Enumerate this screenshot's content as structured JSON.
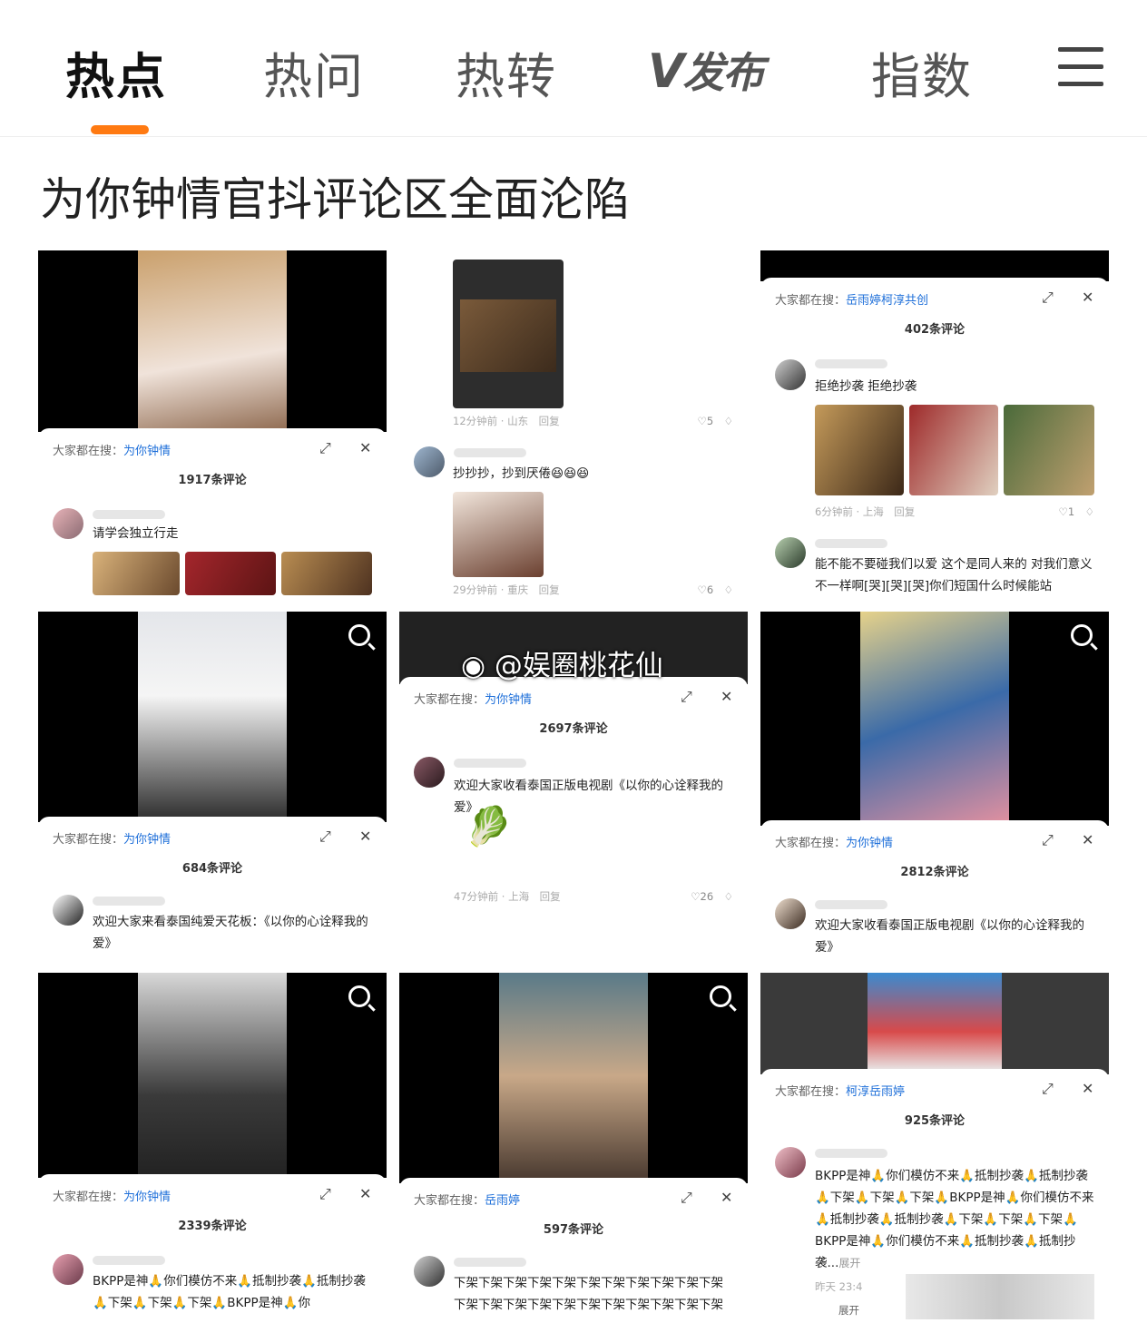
{
  "nav": {
    "tabs": [
      "热点",
      "热问",
      "热转"
    ],
    "publish": {
      "mark": "V",
      "label": "发布"
    },
    "index_tab": "指数",
    "accent": "#ff7a12"
  },
  "headline": "为你钟情官抖评论区全面沦陷",
  "search_label": "大家都在搜：",
  "cards": [
    {
      "keyword": "为你钟情",
      "count": "1917条评论",
      "comment": "请学会独立行走"
    },
    {
      "top_meta": "12分钟前 · 山东",
      "top_reply": "回复",
      "top_likes": "5",
      "comment": "抄抄抄，抄到厌倦😆😆😆",
      "meta": "29分钟前 · 重庆",
      "reply": "回复",
      "likes": "6"
    },
    {
      "keyword": "岳雨婷柯淳共创",
      "count": "402条评论",
      "comment": "拒绝抄袭 拒绝抄袭",
      "meta": "6分钟前 · 上海",
      "reply": "回复",
      "likes": "1",
      "comment2": "能不能不要碰我们以爱 这个是同人来的 对我们意义不一样啊[哭][哭][哭]你们短国什么时候能站"
    },
    {
      "keyword": "为你钟情",
      "count": "684条评论",
      "comment": "欢迎大家来看泰国纯爱天花板：《以你的心诠释我的爱》"
    },
    {
      "keyword": "为你钟情",
      "count": "2697条评论",
      "comment": "欢迎大家收看泰国正版电视剧《以你的心诠释我的爱》",
      "meta": "47分钟前 · 上海",
      "reply": "回复",
      "likes": "26"
    },
    {
      "keyword": "为你钟情",
      "count": "2812条评论",
      "comment": "欢迎大家收看泰国正版电视剧《以你的心诠释我的爱》"
    },
    {
      "keyword": "为你钟情",
      "count": "2339条评论",
      "comment": "BKPP是神🙏你们模仿不来🙏抵制抄袭🙏抵制抄袭🙏下架🙏下架🙏下架🙏BKPP是神🙏你"
    },
    {
      "keyword": "岳雨婷",
      "count": "597条评论",
      "comment": "下架下架下架下架下架下架下架下架下架下架下架下架下架下架下架下架下架下架下架下架下架下架"
    },
    {
      "keyword": "柯淳岳雨婷",
      "count": "925条评论",
      "comment": "BKPP是神🙏你们模仿不来🙏抵制抄袭🙏抵制抄袭🙏下架🙏下架🙏下架🙏BKPP是神🙏你们模仿不来🙏抵制抄袭🙏抵制抄袭🙏下架🙏下架🙏下架🙏BKPP是神🙏你们模仿不来🙏抵制抄袭🙏抵制抄袭...",
      "expand": "展开",
      "meta": "昨天 23:4",
      "expand2": "展开"
    }
  ],
  "watermark": "@娱圈桃花仙"
}
